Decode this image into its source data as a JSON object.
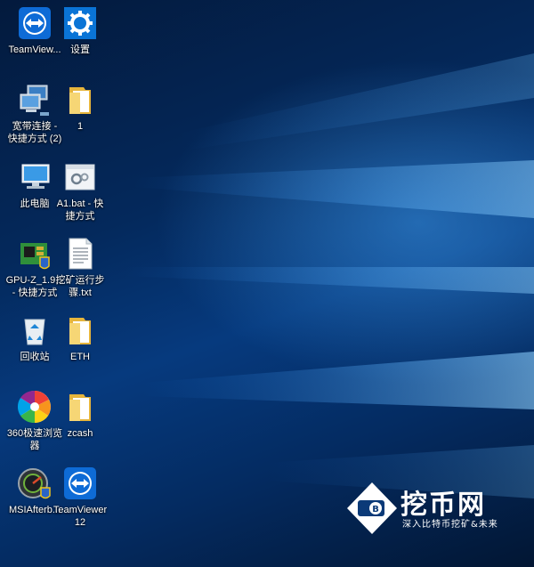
{
  "desktop": {
    "icons": [
      {
        "label": "TeamView...",
        "icon": "teamviewer-icon"
      },
      {
        "label": "设置",
        "icon": "settings-gear-icon"
      },
      {
        "label": "宽带连接 -\n快捷方式 (2)",
        "icon": "network-connection-icon"
      },
      {
        "label": "1",
        "icon": "folder-icon"
      },
      {
        "label": "此电脑",
        "icon": "this-pc-icon"
      },
      {
        "label": "A1.bat - 快\n捷方式",
        "icon": "batch-file-icon"
      },
      {
        "label": "GPU-Z_1.9...\n- 快捷方式",
        "icon": "gpuz-icon"
      },
      {
        "label": "挖矿运行步\n骤.txt",
        "icon": "text-file-icon"
      },
      {
        "label": "回收站",
        "icon": "recycle-bin-icon"
      },
      {
        "label": "ETH",
        "icon": "folder-icon"
      },
      {
        "label": "360极速浏览\n器",
        "icon": "browser-360-icon"
      },
      {
        "label": "zcash",
        "icon": "folder-icon"
      },
      {
        "label": "MSIAfterb...",
        "icon": "msi-afterburner-icon"
      },
      {
        "label": "TeamViewer\n12",
        "icon": "teamviewer-icon"
      }
    ]
  },
  "watermark": {
    "brand": "挖币网",
    "slogan": "深入比特币挖矿&未来",
    "logo_glyph": "B"
  },
  "colors": {
    "teamviewer_blue": "#0e6bd6",
    "settings_blue": "#0a74d6",
    "folder_yellow": "#f2c94c"
  }
}
